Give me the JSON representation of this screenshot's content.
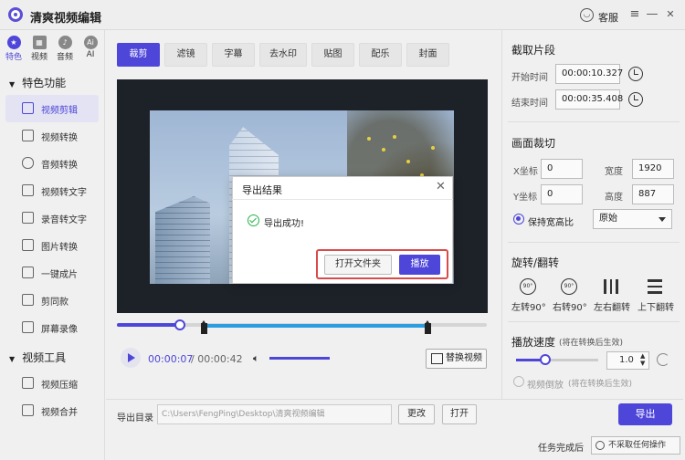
{
  "app": {
    "title": "清爽视频编辑"
  },
  "window": {
    "service_label": "客服",
    "min": "—",
    "max": "☐",
    "close": "✕"
  },
  "sidebar": {
    "categories": [
      {
        "label": "特色",
        "icon": "star-icon"
      },
      {
        "label": "视频",
        "icon": "video-icon"
      },
      {
        "label": "音频",
        "icon": "audio-icon"
      },
      {
        "label": "AI",
        "icon": "ai-icon"
      }
    ],
    "section1": "特色功能",
    "items1": [
      "视频剪辑",
      "视频转换",
      "音频转换",
      "视频转文字",
      "录音转文字",
      "图片转换",
      "一键成片",
      "剪同款",
      "屏幕录像"
    ],
    "section2": "视频工具",
    "items2": [
      "视频压缩",
      "视频合并"
    ]
  },
  "tabs": [
    "裁剪",
    "滤镜",
    "字幕",
    "去水印",
    "贴图",
    "配乐",
    "封面"
  ],
  "player": {
    "current": "00:00:07",
    "separator": " / ",
    "total": "00:00:42",
    "replace_label": "替换视频",
    "progress": 0.17
  },
  "output": {
    "label": "导出目录",
    "path": "C:\\Users\\FengPing\\Desktop\\清爽视频编辑",
    "change": "更改",
    "open": "打开",
    "export": "导出"
  },
  "status": {
    "label": "任务完成后",
    "option": "不采取任何操作"
  },
  "right": {
    "clip_title": "截取片段",
    "start_label": "开始时间",
    "start_value": "00:00:10.327",
    "end_label": "结束时间",
    "end_value": "00:00:35.408",
    "crop_title": "画面裁切",
    "x_label": "X坐标",
    "x_value": "0",
    "y_label": "Y坐标",
    "y_value": "0",
    "w_label": "宽度",
    "w_value": "1920",
    "h_label": "高度",
    "h_value": "887",
    "keep_ratio": "保持宽高比",
    "ratio_value": "原始",
    "rotate_title": "旋转/翻转",
    "rotate_items": [
      {
        "label": "左转90°",
        "glyph": "90°"
      },
      {
        "label": "右转90°",
        "glyph": "90°"
      },
      {
        "label": "左右翻转",
        "glyph": ""
      },
      {
        "label": "上下翻转",
        "glyph": ""
      }
    ],
    "speed_title": "播放速度",
    "speed_note": "(将在转换后生效)",
    "speed_value": "1.0",
    "reverse_label": "视频倒放",
    "reverse_note": "(将在转换后生效)"
  },
  "dialog": {
    "title": "导出结果",
    "message": "导出成功!",
    "open_folder": "打开文件夹",
    "play": "播放",
    "close": "✕"
  },
  "colors": {
    "accent": "#4e46d9",
    "success": "#27b14a",
    "highlight": "#d94a4a"
  }
}
